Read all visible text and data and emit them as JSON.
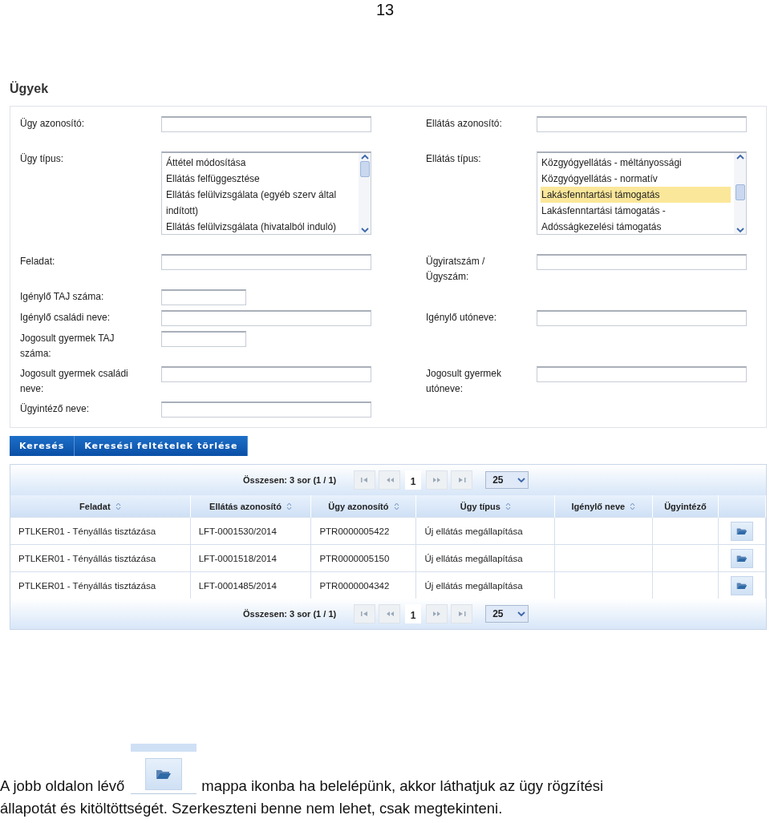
{
  "page_number": "13",
  "title": "Ügyek",
  "form": {
    "rows": [
      {
        "left": {
          "label": "Ügy azonosító:",
          "kind": "text"
        },
        "right": {
          "label": "Ellátás azonosító:",
          "kind": "text"
        }
      },
      {
        "left": {
          "label": "Ügy típus:",
          "kind": "list",
          "items": [
            {
              "label": "Áttétel módosítása",
              "selected": false
            },
            {
              "label": "Ellátás felfüggesztése",
              "selected": false
            },
            {
              "label": "Ellátás felülvizsgálata (egyéb szerv által indított)",
              "selected": false
            },
            {
              "label": "Ellátás felülvizsgálata (hivatalból induló)",
              "selected": false
            }
          ]
        },
        "right": {
          "label": "Ellátás típus:",
          "kind": "list",
          "items": [
            {
              "label": "Közgyógyellátás - méltányossági",
              "selected": false
            },
            {
              "label": "Közgyógyellátás - normatív",
              "selected": false
            },
            {
              "label": "Lakásfenntartási támogatás",
              "selected": true
            },
            {
              "label": "Lakásfenntartási támogatás - Adósságkezelési támogatás",
              "selected": false
            }
          ]
        }
      },
      {
        "left": {
          "label": "Feladat:",
          "kind": "text"
        },
        "right": {
          "label": "Ügyiratszám / Ügyszám:",
          "kind": "text"
        }
      },
      {
        "left": {
          "label": "Igénylő TAJ száma:",
          "kind": "short"
        }
      },
      {
        "left": {
          "label": "Igénylő családi neve:",
          "kind": "text"
        },
        "right": {
          "label": "Igénylő utóneve:",
          "kind": "text"
        }
      },
      {
        "left": {
          "label": "Jogosult gyermek TAJ száma:",
          "kind": "short"
        }
      },
      {
        "left": {
          "label": "Jogosult gyermek családi neve:",
          "kind": "text"
        },
        "right": {
          "label": "Jogosult gyermek utóneve:",
          "kind": "text"
        }
      },
      {
        "left": {
          "label": "Ügyintéző neve:",
          "kind": "text"
        }
      }
    ]
  },
  "buttons": [
    "Keresés",
    "Keresési feltételek törlése"
  ],
  "pagers": [
    {
      "total": "Összesen: 3 sor (1 / 1)",
      "page": "1",
      "page_size": "25"
    },
    {
      "total": "Összesen: 3 sor (1 / 1)",
      "page": "1",
      "page_size": "25"
    }
  ],
  "table": {
    "columns": [
      {
        "label": "Feladat",
        "sortable": true
      },
      {
        "label": "Ellátás azonosító",
        "sortable": true
      },
      {
        "label": "Ügy azonosító",
        "sortable": true
      },
      {
        "label": "Ügy típus",
        "sortable": true
      },
      {
        "label": "Igénylő neve",
        "sortable": true
      },
      {
        "label": "Ügyintéző",
        "sortable": false
      }
    ],
    "rows": [
      [
        "PTLKER01 - Tényállás tisztázása",
        "LFT-0001530/2014",
        "PTR0000005422",
        "Új ellátás megállapítása",
        "",
        ""
      ],
      [
        "PTLKER01 - Tényállás tisztázása",
        "LFT-0001518/2014",
        "PTR0000005150",
        "Új ellátás megállapítása",
        "",
        ""
      ],
      [
        "PTLKER01 - Tényállás tisztázása",
        "LFT-0001485/2014",
        "PTR0000004342",
        "Új ellátás megállapítása",
        "",
        ""
      ]
    ]
  },
  "caption": {
    "before": "A jobb oldalon lévő",
    "after": "mappa ikonba ha belelépünk, akkor láthatjuk az ügy rögzítési",
    "continuation": "állapotát és kitöltöttségét. Szerkeszteni benne nem lehet, csak megtekinteni."
  }
}
